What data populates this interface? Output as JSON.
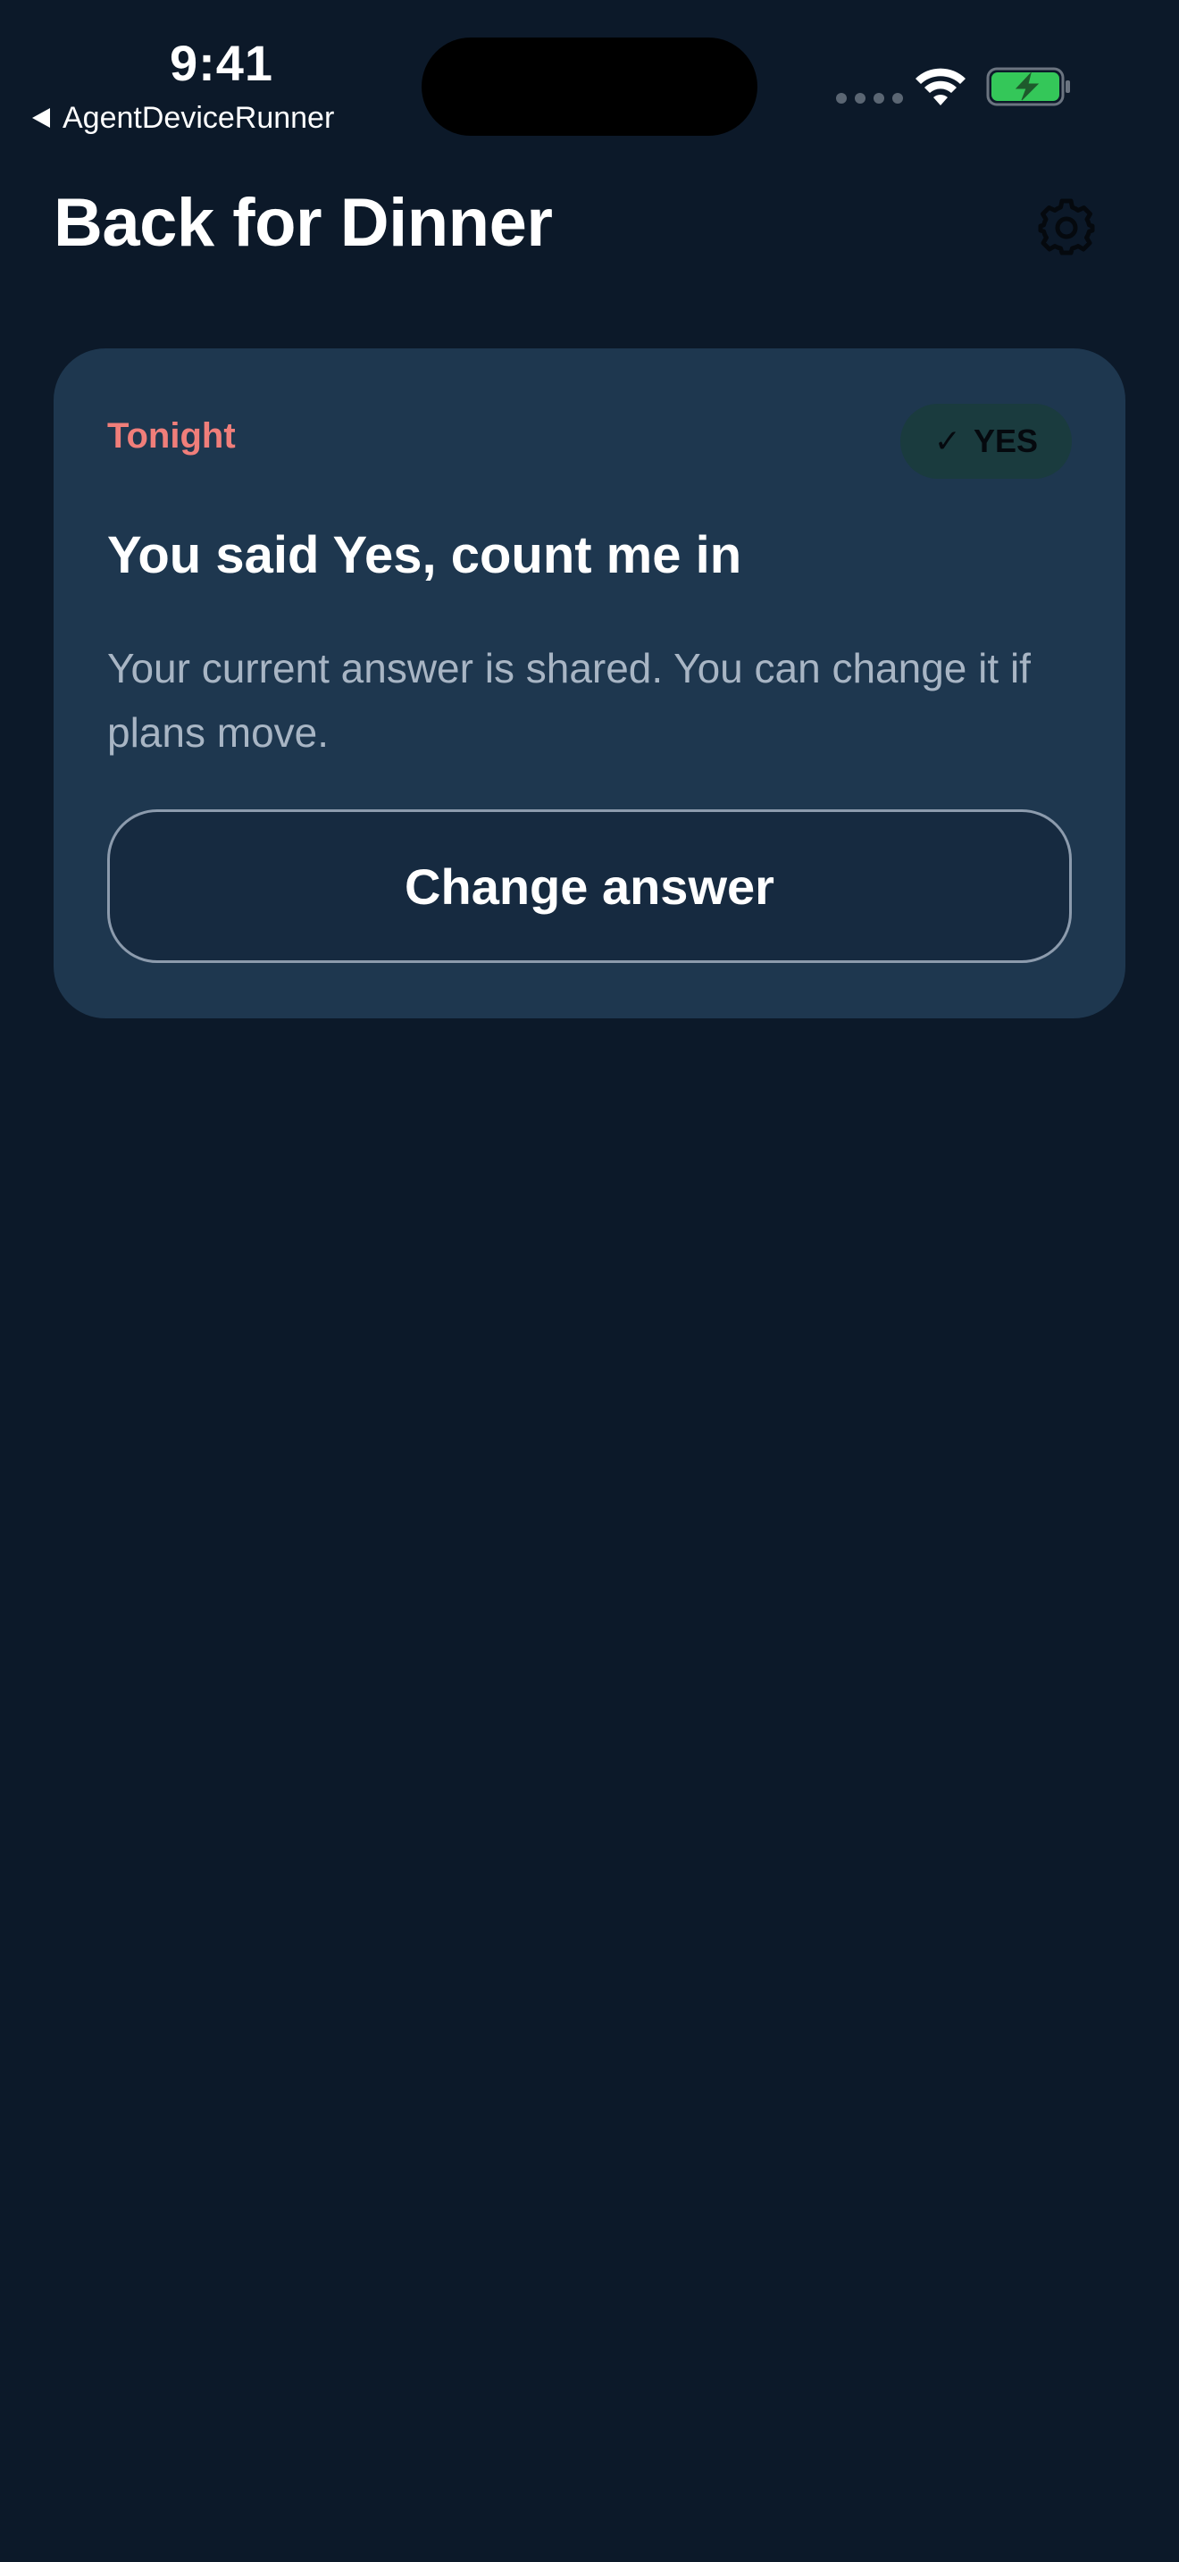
{
  "status_bar": {
    "time": "9:41",
    "back_app_label": "AgentDeviceRunner",
    "battery_color": "#34c759"
  },
  "header": {
    "title": "Back for Dinner",
    "settings_icon": "gear-icon"
  },
  "card": {
    "eyebrow": "Tonight",
    "badge_check": "✓",
    "badge_label": "YES",
    "heading": "You said Yes, count me in",
    "description": "Your current answer is shared. You can change it if plans move.",
    "button_label": "Change answer",
    "accent_color": "#f07e7a"
  }
}
